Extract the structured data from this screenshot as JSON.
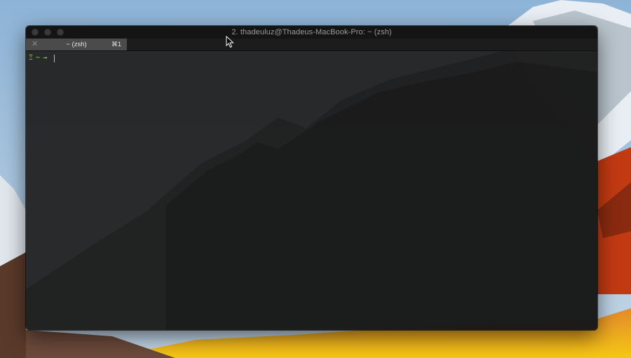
{
  "window": {
    "title": "2. thadeuluz@Thadeus-MacBook-Pro: ~ (zsh)",
    "traffic_lights": [
      "close",
      "minimize",
      "zoom"
    ]
  },
  "tabs": [
    {
      "label": "~ (zsh)",
      "shortcut": "⌘1",
      "active": true
    }
  ],
  "terminal": {
    "prompt_symbol": "Ξ",
    "cwd": "~",
    "arrow": "→",
    "input": ""
  },
  "colors": {
    "prompt_green": "#a6e22e",
    "terminal_bg": "#202020",
    "titlebar_bg": "#141414",
    "tab_active_bg": "#4b4b4b"
  },
  "icons": {
    "tab_close": "close-icon",
    "pointer": "mouse-pointer-icon"
  }
}
